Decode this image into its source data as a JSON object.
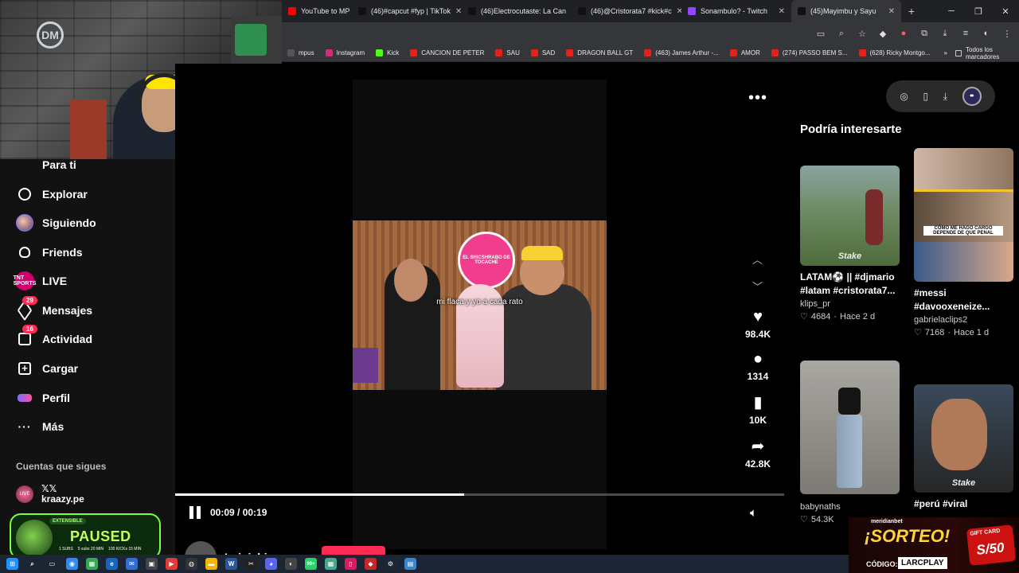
{
  "browser": {
    "tabs": [
      {
        "title": "YouTube to MP",
        "active": false,
        "color": "#ff0000"
      },
      {
        "title": "(46)#capcut #fyp | TikTok",
        "active": false,
        "color": "#111111"
      },
      {
        "title": "(46)Electrocutaste: La Can",
        "active": false,
        "color": "#111111"
      },
      {
        "title": "(46)@Cristorata7 #kick#c",
        "active": false,
        "color": "#111111"
      },
      {
        "title": "Sonambulo? - Twitch",
        "active": false,
        "color": "#9146ff"
      },
      {
        "title": "(45)Mayimbu y Sayu",
        "active": true,
        "color": "#111111"
      }
    ],
    "new_tab": "+",
    "window_controls": [
      "─",
      "❐",
      "✕"
    ],
    "bookmarks": [
      {
        "label": "mpus",
        "color": "#555555"
      },
      {
        "label": "Instagram",
        "color": "#d62976"
      },
      {
        "label": "Kick",
        "color": "#53fc18"
      },
      {
        "label": "CANCION DE PETER",
        "color": "#e62117"
      },
      {
        "label": "SAU",
        "color": "#e62117"
      },
      {
        "label": "SAD",
        "color": "#e62117"
      },
      {
        "label": "DRAGON BALL GT",
        "color": "#e62117"
      },
      {
        "label": "(463) James Arthur -...",
        "color": "#e62117"
      },
      {
        "label": "AMOR",
        "color": "#e62117"
      },
      {
        "label": "(274) PASSO BEM S...",
        "color": "#e62117"
      },
      {
        "label": "(628) Ricky Montgo...",
        "color": "#e62117"
      }
    ],
    "bookmarks_more": "»",
    "all_bookmarks": "Todos los marcadores"
  },
  "webcam": {
    "logo": "DM"
  },
  "sidebar": {
    "items": [
      {
        "label": "Para ti",
        "icon": "home-icon",
        "badge": ""
      },
      {
        "label": "Explorar",
        "icon": "compass-icon",
        "badge": ""
      },
      {
        "label": "Siguiendo",
        "icon": "following-avatar-icon",
        "badge": ""
      },
      {
        "label": "Friends",
        "icon": "friends-icon",
        "badge": ""
      },
      {
        "label": "LIVE",
        "icon": "live-icon",
        "badge": ""
      },
      {
        "label": "Mensajes",
        "icon": "messages-icon",
        "badge": "29"
      },
      {
        "label": "Actividad",
        "icon": "activity-icon",
        "badge": "16"
      },
      {
        "label": "Cargar",
        "icon": "upload-icon",
        "badge": ""
      },
      {
        "label": "Perfil",
        "icon": "profile-icon",
        "badge": ""
      },
      {
        "label": "Más",
        "icon": "more-icon",
        "badge": ""
      }
    ],
    "live_icon_text": "TNT SPORTS",
    "following_heading": "Cuentas que sigues",
    "following_account": {
      "line1": "𝕏𝕏",
      "line2": "kraazy.pe"
    }
  },
  "paused_overlay": {
    "badge": "EXTENSIBLE",
    "word": "PAUSED",
    "stats": [
      "1 SUBS",
      "5 subs 20 MIN",
      "100 KICKs 15 MIN"
    ]
  },
  "video": {
    "sign_text": "EL SHICSHRABO DE TOCACHE",
    "caption": "mi flaca y yo a cada rato",
    "more": "•••",
    "likes": "98.4K",
    "comments": "1314",
    "saves": "10K",
    "shares": "42.8K",
    "time": "00:09 / 00:19",
    "progress": 0.474,
    "author": "Luinishir"
  },
  "right_panel": {
    "title": "Podría interesarte",
    "cards": [
      {
        "caption": "LATAM⚽ || #djmario",
        "caption2": "#latam #cristorata7...",
        "user": "klips_pr",
        "likes": "4684",
        "age": "Hace 2 d",
        "stake": "Stake"
      },
      {
        "caption": "#messi",
        "caption2": "#davooxeneize...",
        "user": "gabrielaclips2",
        "likes": "7168",
        "age": "Hace 1 d",
        "stake": "",
        "overlay": "CÓMO ME HAGO CARGO DEPENDE DE QUE PENAL"
      },
      {
        "caption": "",
        "caption2": "",
        "user": "babynaths",
        "likes": "54.3K",
        "age": "",
        "stake": ""
      },
      {
        "caption": "#perú #viral",
        "caption2": "",
        "user": "",
        "likes": "",
        "age": "",
        "stake": "Stake"
      }
    ]
  },
  "promo": {
    "brand": "meridianbet",
    "headline": "¡SORTEO!",
    "code_label": "CÓDIGO:",
    "code": "LARCPLAY",
    "gift_label": "GIFT CARD",
    "gift_value": "S/50"
  },
  "taskbar": {
    "badge": "99+"
  }
}
